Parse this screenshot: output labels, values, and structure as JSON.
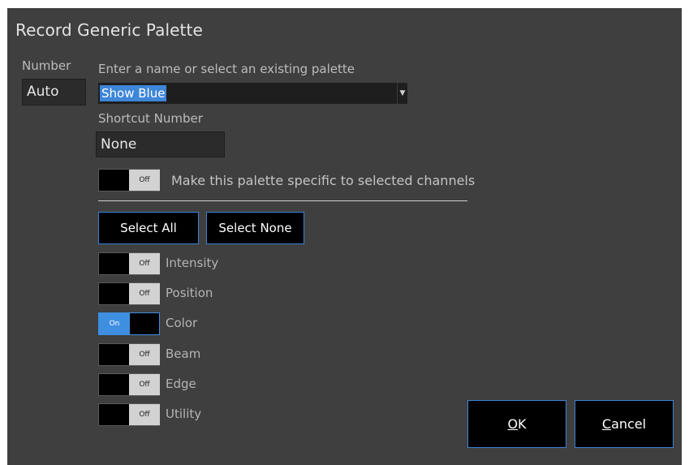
{
  "dialog": {
    "title": "Record Generic Palette",
    "number_label": "Number",
    "number_value": "Auto",
    "name_label": "Enter a name or select an existing palette",
    "name_value": "Show Blue",
    "shortcut_label": "Shortcut Number",
    "shortcut_value": "None",
    "specific_toggle": {
      "state": "Off",
      "label": "Make this palette specific to selected channels"
    },
    "select_all_label": "Select All",
    "select_none_label": "Select None",
    "toggles": [
      {
        "label": "Intensity",
        "state": "Off"
      },
      {
        "label": "Position",
        "state": "Off"
      },
      {
        "label": "Color",
        "state": "On"
      },
      {
        "label": "Beam",
        "state": "Off"
      },
      {
        "label": "Edge",
        "state": "Off"
      },
      {
        "label": "Utility",
        "state": "Off"
      }
    ],
    "ok_label": {
      "underlined": "O",
      "rest": "K"
    },
    "cancel_label": {
      "underlined": "C",
      "rest": "ancel"
    }
  },
  "colors": {
    "dialog_bg": "#3f3f3f",
    "accent": "#3e8fe0",
    "selection": "#3d86d8"
  }
}
